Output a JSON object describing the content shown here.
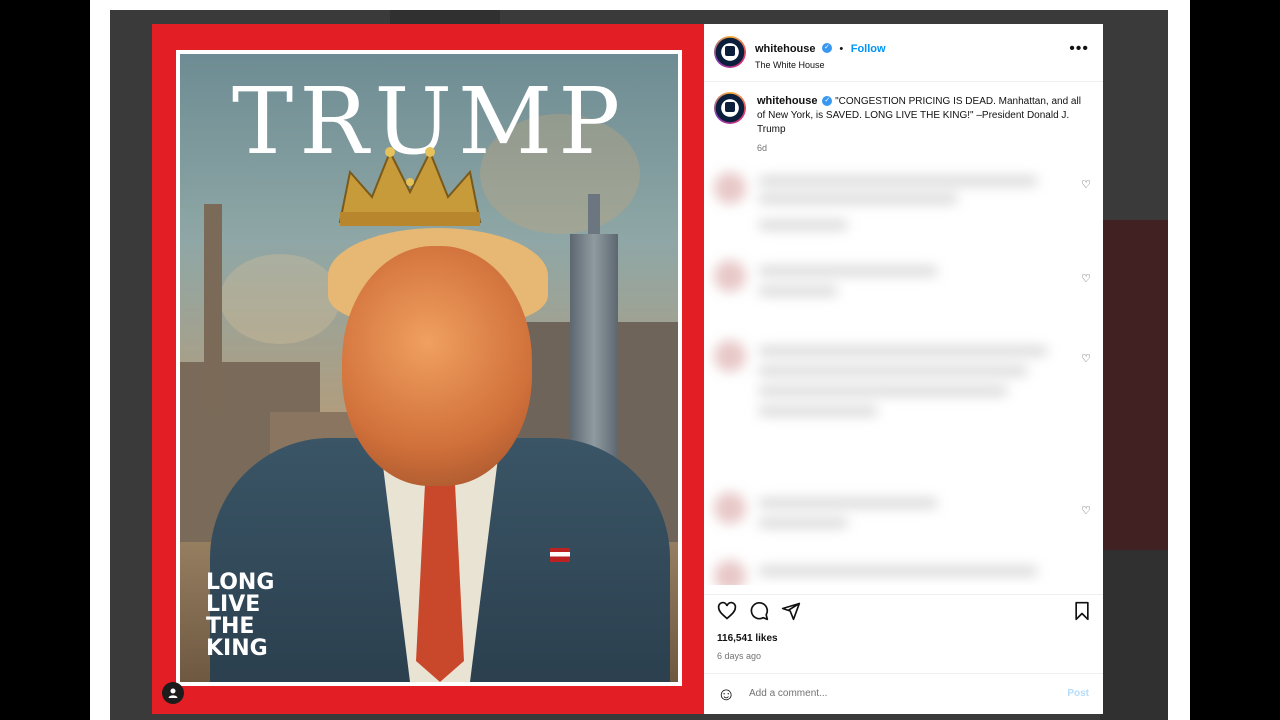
{
  "cover": {
    "title": "TRUMP",
    "tagline": [
      "LONG",
      "LIVE",
      "THE",
      "KING"
    ]
  },
  "header": {
    "username": "whitehouse",
    "follow_label": "Follow",
    "subtitle": "The White House",
    "more_label": "•••"
  },
  "caption": {
    "username": "whitehouse",
    "text": "\"CONGESTION PRICING IS DEAD. Manhattan, and all of New York, is SAVED. LONG LIVE THE KING!\" –President Donald J. Trump",
    "time": "6d"
  },
  "engagement": {
    "likes": "116,541 likes",
    "posted": "6 days ago"
  },
  "comment_box": {
    "placeholder": "Add a comment...",
    "post_label": "Post"
  },
  "icons": {
    "like": "heart-icon",
    "comment": "comment-icon",
    "share": "share-icon",
    "save": "bookmark-icon",
    "emoji": "emoji-icon"
  },
  "colors": {
    "cover_border": "#e31e24",
    "follow": "#0095f6",
    "verified": "#3897f0"
  }
}
